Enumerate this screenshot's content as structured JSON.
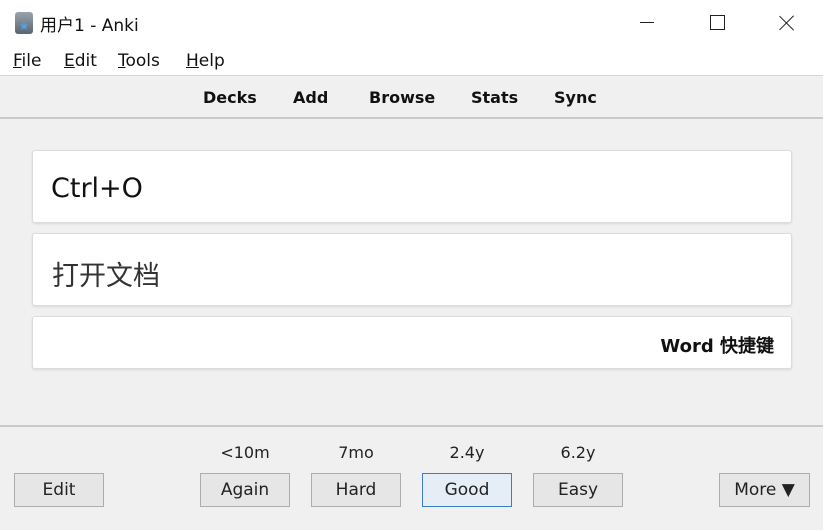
{
  "window": {
    "title": "用户1 - Anki",
    "icons": [
      "app-icon",
      "minimize-icon",
      "maximize-icon",
      "close-icon"
    ]
  },
  "menu": {
    "items": [
      "File",
      "Edit",
      "Tools",
      "Help"
    ]
  },
  "toolbar": {
    "links": [
      "Decks",
      "Add",
      "Browse",
      "Stats",
      "Sync"
    ]
  },
  "card": {
    "front": "Ctrl+O",
    "back": "打开文档",
    "tag": "Word 快捷键"
  },
  "answer_bar": {
    "edit_label": "Edit",
    "more_label": "More ▼",
    "buttons": [
      {
        "label": "Again",
        "interval": "<10m"
      },
      {
        "label": "Hard",
        "interval": "7mo"
      },
      {
        "label": "Good",
        "interval": "2.4y"
      },
      {
        "label": "Easy",
        "interval": "6.2y"
      }
    ]
  },
  "colors": {
    "background": "#f0f0f0",
    "field_background": "#ffffff",
    "focus_border": "#3c7fc1"
  }
}
